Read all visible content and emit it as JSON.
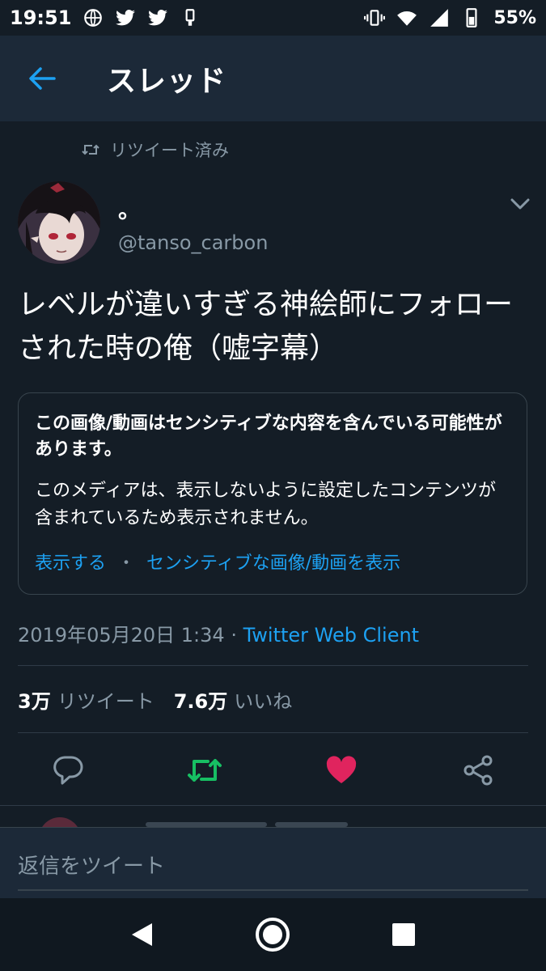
{
  "status_bar": {
    "time": "19:51",
    "battery_text": "55%"
  },
  "header": {
    "title": "スレッド"
  },
  "tweet": {
    "retweeted_label": "リツイート済み",
    "author_name": "。",
    "author_handle": "@tanso_carbon",
    "text": "レベルが違いすぎる神絵師にフォローされた時の俺（嘘字幕）",
    "sensitive_title": "この画像/動画はセンシティブな内容を含んでいる可能性があります。",
    "sensitive_body": "このメディアは、表示しないように設定したコンテンツが含まれているため表示されません。",
    "show_label": "表示する",
    "separator": "・",
    "show_sensitive_label": "センシティブな画像/動画を表示",
    "timestamp": "2019年05月20日 1:34",
    "meta_separator": " · ",
    "client": "Twitter Web Client",
    "retweet_count": "3万",
    "retweet_label": "リツイート",
    "like_count": "7.6万",
    "like_label": "いいね"
  },
  "reply": {
    "placeholder": "返信をツイート"
  },
  "colors": {
    "background": "#141d26",
    "header": "#1c2938",
    "accent": "#1da1f2",
    "retweet": "#17bf63",
    "like": "#e0245e",
    "muted": "#8899a6"
  }
}
